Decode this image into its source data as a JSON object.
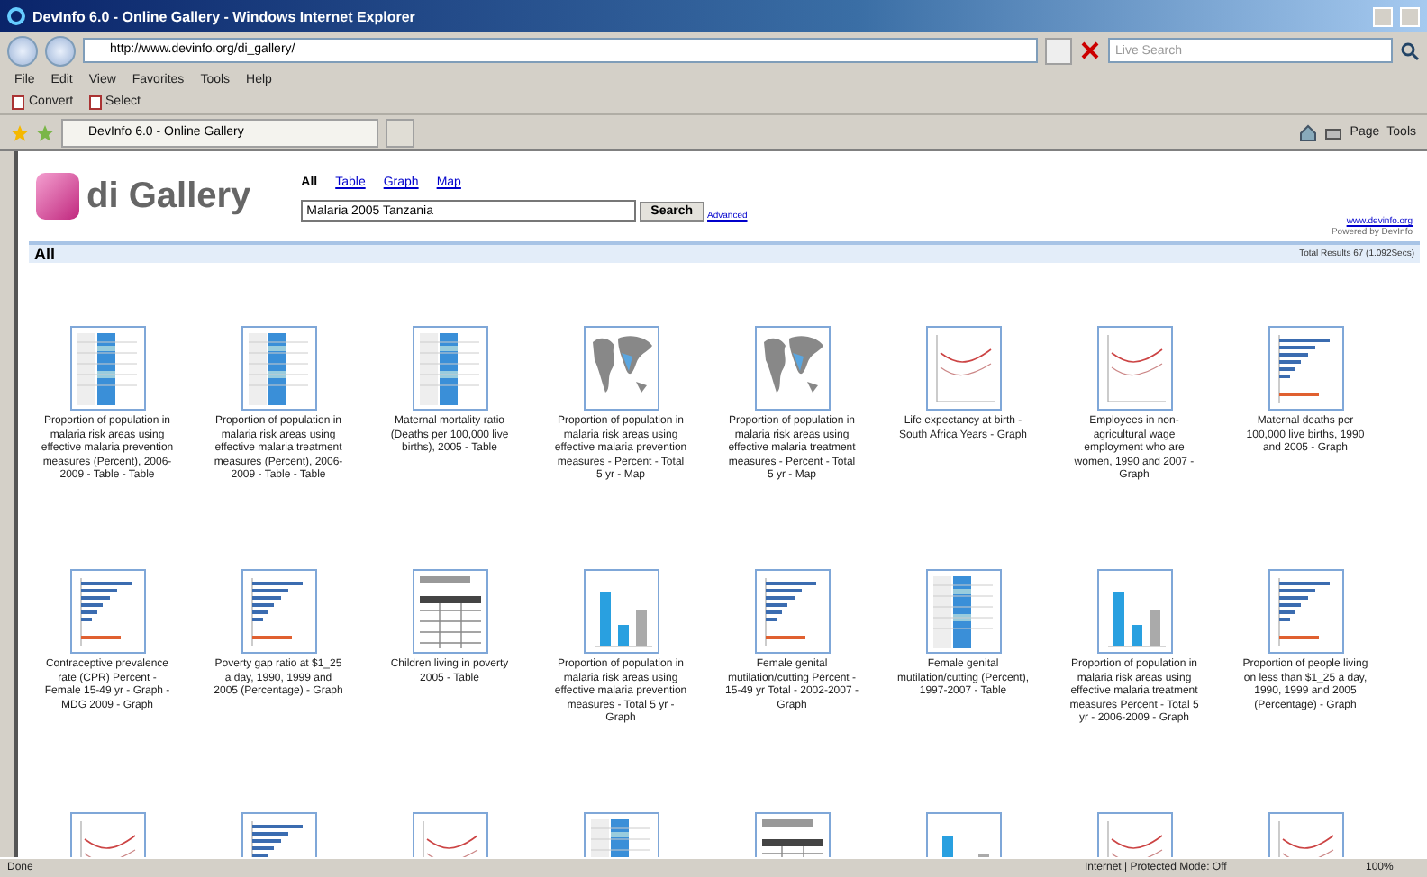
{
  "window": {
    "title": "DevInfo 6.0 - Online Gallery - Windows Internet Explorer"
  },
  "address_bar": {
    "url": "http://www.devinfo.org/di_gallery/",
    "search_placeholder": "Live Search"
  },
  "menu": [
    "File",
    "Edit",
    "View",
    "Favorites",
    "Tools",
    "Help"
  ],
  "command_bar": [
    "Convert",
    "Select"
  ],
  "tab": {
    "title": "DevInfo 6.0 - Online Gallery"
  },
  "toolbar_right": [
    "Page",
    "Tools"
  ],
  "page": {
    "logo": "di Gallery",
    "filters": [
      {
        "label": "All",
        "selected": true
      },
      {
        "label": "Table",
        "selected": false
      },
      {
        "label": "Graph",
        "selected": false
      },
      {
        "label": "Map",
        "selected": false
      }
    ],
    "search": {
      "value": "Malaria 2005 Tanzania",
      "button": "Search",
      "advanced": "Advanced"
    },
    "site_link": "www.devinfo.org",
    "powered_by": "Powered by DevInfo",
    "section": "All",
    "total_results": "Total Results 67 (1.092Secs)",
    "items": [
      {
        "kind": "table",
        "caption": "Proportion of population in malaria risk areas using effective malaria prevention measures (Percent), 2006-2009 - Table - Table"
      },
      {
        "kind": "table",
        "caption": "Proportion of population in malaria risk areas using effective malaria treatment measures (Percent), 2006-2009 - Table - Table"
      },
      {
        "kind": "table",
        "caption": "Maternal mortality ratio (Deaths per 100,000 live births), 2005 - Table"
      },
      {
        "kind": "map",
        "caption": "Proportion of population in malaria risk areas using effective malaria prevention measures - Percent - Total 5 yr - Map"
      },
      {
        "kind": "map",
        "caption": "Proportion of population in malaria risk areas using effective malaria treatment measures - Percent - Total 5 yr - Map"
      },
      {
        "kind": "line",
        "caption": "Life expectancy at birth - South Africa Years - Graph"
      },
      {
        "kind": "line",
        "caption": "Employees in non-agricultural wage employment who are women, 1990 and 2007 - Graph"
      },
      {
        "kind": "hbar",
        "caption": "Maternal deaths per 100,000 live births, 1990 and 2005 - Graph"
      },
      {
        "kind": "hbar",
        "caption": "Contraceptive prevalence rate (CPR) Percent - Female 15-49 yr - Graph - MDG 2009 - Graph"
      },
      {
        "kind": "hbar",
        "caption": "Poverty gap ratio at $1_25 a day, 1990, 1999 and 2005 (Percentage) - Graph"
      },
      {
        "kind": "grid",
        "caption": "Children living in poverty 2005 - Table"
      },
      {
        "kind": "bar",
        "caption": "Proportion of population in malaria risk areas using effective malaria prevention measures - Total 5 yr - Graph"
      },
      {
        "kind": "hbar",
        "caption": "Female genital mutilation/cutting Percent - 15-49 yr Total - 2002-2007 - Graph"
      },
      {
        "kind": "table",
        "caption": "Female genital mutilation/cutting (Percent), 1997-2007 - Table"
      },
      {
        "kind": "bar",
        "caption": "Proportion of population in malaria risk areas using effective malaria treatment measures Percent - Total 5 yr - 2006-2009 - Graph"
      },
      {
        "kind": "hbar",
        "caption": "Proportion of people living on less than $1_25 a day, 1990, 1999 and 2005 (Percentage) - Graph"
      },
      {
        "kind": "line"
      },
      {
        "kind": "hbar"
      },
      {
        "kind": "line"
      },
      {
        "kind": "table"
      },
      {
        "kind": "grid"
      },
      {
        "kind": "bar"
      },
      {
        "kind": "line"
      },
      {
        "kind": "line"
      }
    ]
  },
  "status_bar": {
    "status": "Done",
    "zone": "Internet | Protected Mode: Off",
    "zoom": "100%"
  }
}
